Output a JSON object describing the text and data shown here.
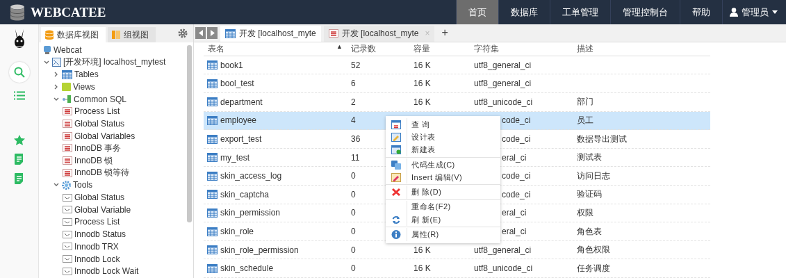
{
  "header": {
    "brand": "WEBCATEE",
    "nav": [
      {
        "label": "首页",
        "selected": true
      },
      {
        "label": "数据库",
        "selected": false
      },
      {
        "label": "工单管理",
        "selected": false
      },
      {
        "label": "管理控制台",
        "selected": false
      },
      {
        "label": "帮助",
        "selected": false
      }
    ],
    "user": "管理员"
  },
  "sidebar_tabs": [
    {
      "label": "数据库视图",
      "selected": true
    },
    {
      "label": "组视图",
      "selected": false
    }
  ],
  "tree": [
    {
      "label": "Webcat",
      "kind": "server",
      "children": [
        {
          "label": "[开发环境] localhost_mytest",
          "kind": "connection",
          "expanded": true,
          "children": [
            {
              "label": "Tables",
              "kind": "tables",
              "expanded": false
            },
            {
              "label": "Views",
              "kind": "views",
              "expanded": false
            },
            {
              "label": "Common SQL",
              "kind": "group",
              "expanded": true,
              "children": [
                {
                  "label": "Process List",
                  "kind": "sql"
                },
                {
                  "label": "Global Status",
                  "kind": "sql"
                },
                {
                  "label": "Global Variables",
                  "kind": "sql"
                },
                {
                  "label": "InnoDB 事务",
                  "kind": "sql"
                },
                {
                  "label": "InnoDB 锁",
                  "kind": "sql"
                },
                {
                  "label": "InnoDB 锁等待",
                  "kind": "sql"
                }
              ]
            },
            {
              "label": "Tools",
              "kind": "tools",
              "expanded": true,
              "children": [
                {
                  "label": "Global Status",
                  "kind": "tool"
                },
                {
                  "label": "Global Variable",
                  "kind": "tool"
                },
                {
                  "label": "Process List",
                  "kind": "tool"
                },
                {
                  "label": "Innodb Status",
                  "kind": "tool"
                },
                {
                  "label": "Innodb TRX",
                  "kind": "tool"
                },
                {
                  "label": "Innodb Lock",
                  "kind": "tool"
                },
                {
                  "label": "Innodb Lock Wait",
                  "kind": "tool"
                }
              ]
            }
          ]
        }
      ]
    }
  ],
  "editor_tabs": [
    {
      "label": "开发 [localhost_myte",
      "kind": "table",
      "selected": true
    },
    {
      "label": "开发 [localhost_myte",
      "kind": "sql",
      "selected": false,
      "close": "×"
    }
  ],
  "add_tab": "+",
  "table": {
    "columns": [
      {
        "label": "表名",
        "sort": "▲"
      },
      {
        "label": "记录数"
      },
      {
        "label": "容量"
      },
      {
        "label": "字符集"
      },
      {
        "label": "描述"
      }
    ],
    "rows": [
      {
        "name": "book1",
        "records": "52",
        "size": "16 K",
        "charset": "utf8_general_ci",
        "selected": false
      },
      {
        "name": "bool_test",
        "records": "6",
        "size": "16 K",
        "charset": "utf8_general_ci",
        "selected": false
      },
      {
        "name": "department",
        "records": "2",
        "size": "16 K",
        "charset": "utf8_unicode_ci",
        "description": "部门",
        "selected": false
      },
      {
        "name": "employee",
        "records": "4",
        "charset": "code_ci",
        "description": "员工",
        "selected": true,
        "under_menu": true
      },
      {
        "name": "export_test",
        "records": "36",
        "charset": "code_ci",
        "description": "数据导出测试",
        "selected": false,
        "under_menu": true
      },
      {
        "name": "my_test",
        "records": "11",
        "charset": "eral_ci",
        "description": "测试表",
        "selected": false,
        "under_menu": true
      },
      {
        "name": "skin_access_log",
        "records": "0",
        "charset": "code_ci",
        "description": "访问日志",
        "selected": false,
        "under_menu": true
      },
      {
        "name": "skin_captcha",
        "records": "0",
        "charset": "code_ci",
        "description": "验证码",
        "selected": false,
        "under_menu": true
      },
      {
        "name": "skin_permission",
        "records": "0",
        "charset": "eral_ci",
        "description": "权限",
        "selected": false,
        "under_menu": true
      },
      {
        "name": "skin_role",
        "records": "0",
        "charset": "eral_ci",
        "description": "角色表",
        "selected": false,
        "under_menu": true
      },
      {
        "name": "skin_role_permission",
        "records": "0",
        "size": "16 K",
        "charset": "utf8_general_ci",
        "description": "角色权限",
        "selected": false
      },
      {
        "name": "skin_schedule",
        "records": "0",
        "size": "16 K",
        "charset": "utf8_unicode_ci",
        "description": "任务调度",
        "selected": false
      }
    ]
  },
  "context_menu": {
    "groups": [
      [
        {
          "label": "查 询",
          "kind": "query"
        },
        {
          "label": "设计表",
          "kind": "design"
        },
        {
          "label": "新建表",
          "kind": "new"
        }
      ],
      [
        {
          "label": "代码生成(C)",
          "kind": "codegen"
        },
        {
          "label": "Insert 编辑(V)",
          "kind": "insert"
        }
      ],
      [
        {
          "label": "删 除(D)",
          "kind": "delete"
        }
      ],
      [
        {
          "label": "重命名(F2)",
          "kind": "rename"
        },
        {
          "label": "刷 新(E)",
          "kind": "refresh"
        }
      ],
      [
        {
          "label": "属性(R)",
          "kind": "properties"
        }
      ]
    ]
  }
}
